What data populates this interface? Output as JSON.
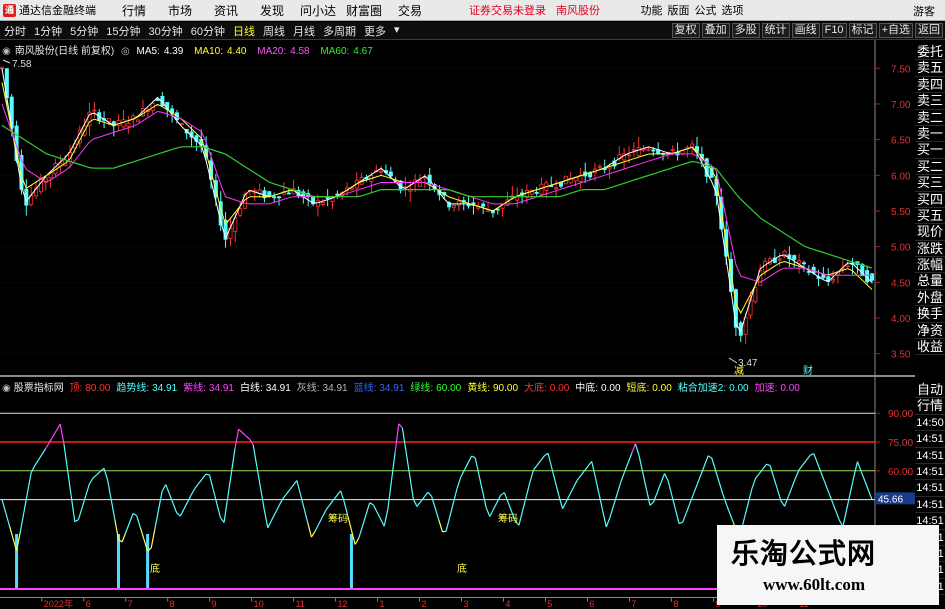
{
  "menubar": {
    "logo_glyph": "通",
    "app_title": "通达信金融终端",
    "items": [
      "行情",
      "市场",
      "资讯",
      "发现",
      "问小达",
      "财富圈",
      "交易"
    ],
    "login_warning": "证券交易未登录",
    "stock_name": "南风股份",
    "right_items": [
      "功能",
      "版面",
      "公式",
      "选项"
    ],
    "guest": "游客"
  },
  "toolbar": {
    "periods": [
      "分时",
      "1分钟",
      "5分钟",
      "15分钟",
      "30分钟",
      "60分钟",
      "日线",
      "周线",
      "月线",
      "多周期",
      "更多"
    ],
    "active_period": "日线",
    "right_buttons": [
      "复权",
      "叠加",
      "多股",
      "统计",
      "画线",
      "F10",
      "标记",
      "+自选",
      "返回"
    ]
  },
  "main_chart": {
    "title": "南风股份(日线 前复权)",
    "ma": [
      {
        "label": "MA5:",
        "value": "4.39",
        "color": "#ffffff"
      },
      {
        "label": "MA10:",
        "value": "4.40",
        "color": "#ffff33"
      },
      {
        "label": "MA20:",
        "value": "4.58",
        "color": "#ff33ff"
      },
      {
        "label": "MA60:",
        "value": "4.67",
        "color": "#33ee33"
      }
    ],
    "high_label": "7.58",
    "low_label": "3.47",
    "markers": [
      "减",
      "财"
    ],
    "price_axis": [
      "7.50",
      "7.00",
      "6.50",
      "6.00",
      "5.50",
      "5.00",
      "4.50",
      "4.00",
      "3.50"
    ],
    "colors": {
      "up": "#ff3232",
      "down": "#54ffff",
      "ma5": "#ffffff",
      "ma10": "#ffff33",
      "ma20": "#ff33ff",
      "ma60": "#33cc33"
    }
  },
  "quote_tabs": [
    "委托",
    "卖五",
    "卖四",
    "卖三",
    "卖二",
    "卖一",
    "买一",
    "买二",
    "买三",
    "买四",
    "买五",
    "现价",
    "涨跌",
    "涨幅",
    "总量",
    "外盘",
    "换手",
    "净资",
    "收益"
  ],
  "time_tabs": [
    "自动",
    "行情",
    "14:50",
    "14:51",
    "14:51",
    "14:51",
    "14:51",
    "14:51",
    "14:51",
    "14:51",
    "14:51",
    "14:51",
    "14:51"
  ],
  "indicator": {
    "name": "股票指标网",
    "params": [
      {
        "label": "顶:",
        "value": "80.00",
        "color": "#ff3333"
      },
      {
        "label": "趋势线:",
        "value": "34.91",
        "color": "#55ffff"
      },
      {
        "label": "紫线:",
        "value": "34.91",
        "color": "#ff44ff"
      },
      {
        "label": "白线:",
        "value": "34.91",
        "color": "#ffffff"
      },
      {
        "label": "灰线:",
        "value": "34.91",
        "color": "#bbbbbb"
      },
      {
        "label": "蓝线:",
        "value": "34.91",
        "color": "#3366ff"
      },
      {
        "label": "绿线:",
        "value": "60.00",
        "color": "#33ff33"
      },
      {
        "label": "黄线:",
        "value": "90.00",
        "color": "#ffff33"
      },
      {
        "label": "大底:",
        "value": "0.00",
        "color": "#ff3333"
      },
      {
        "label": "中底:",
        "value": "0.00",
        "color": "#ffffff"
      },
      {
        "label": "短底:",
        "value": "0.00",
        "color": "#ffff33"
      },
      {
        "label": "粘合加速2:",
        "value": "0.00",
        "color": "#55ffff"
      },
      {
        "label": "加速:",
        "value": "0.00",
        "color": "#ff44ff"
      }
    ],
    "axis": [
      "90.00",
      "75.00",
      "60.00",
      "45.00"
    ],
    "current": "45.66",
    "labels": [
      "底",
      "筹码",
      "底",
      "筹码"
    ]
  },
  "date_axis": [
    "2022年",
    "6",
    "7",
    "8",
    "9",
    "10",
    "11",
    "12",
    "1",
    "2",
    "3",
    "4",
    "5",
    "6",
    "7",
    "8",
    "9",
    "10",
    "11"
  ],
  "watermark": {
    "title": "乐淘公式网",
    "url": "www.60lt.com"
  },
  "chart_data": [
    {
      "type": "line",
      "title": "南风股份(日线 前复权)",
      "ylim": [
        3.3,
        7.7
      ],
      "series": [
        {
          "name": "MA5",
          "values": [
            7.5,
            5.6,
            6.0,
            6.3,
            6.9,
            6.7,
            6.8,
            7.1,
            6.7,
            6.4,
            5.1,
            5.8,
            5.7,
            5.8,
            5.6,
            5.7,
            5.9,
            6.1,
            5.8,
            6.0,
            5.6,
            5.6,
            5.5,
            5.7,
            5.8,
            5.9,
            6.0,
            6.1,
            6.3,
            6.4,
            6.3,
            6.4,
            5.8,
            3.7,
            4.7,
            4.9,
            4.7,
            4.5,
            4.8,
            4.5
          ]
        },
        {
          "name": "MA10",
          "values": [
            7.3,
            5.8,
            6.0,
            6.2,
            6.8,
            6.7,
            6.8,
            7.0,
            6.8,
            6.5,
            5.3,
            5.7,
            5.7,
            5.8,
            5.7,
            5.7,
            5.9,
            6.0,
            5.9,
            5.9,
            5.7,
            5.6,
            5.5,
            5.7,
            5.8,
            5.9,
            6.0,
            6.1,
            6.2,
            6.3,
            6.3,
            6.4,
            6.0,
            4.0,
            4.6,
            4.8,
            4.7,
            4.6,
            4.7,
            4.4
          ]
        },
        {
          "name": "MA20",
          "values": [
            7.0,
            6.1,
            5.9,
            6.1,
            6.5,
            6.6,
            6.7,
            6.9,
            6.8,
            6.6,
            5.7,
            5.6,
            5.6,
            5.7,
            5.7,
            5.7,
            5.8,
            5.9,
            5.9,
            5.9,
            5.8,
            5.7,
            5.6,
            5.6,
            5.7,
            5.8,
            5.9,
            6.0,
            6.1,
            6.2,
            6.3,
            6.3,
            6.1,
            4.6,
            4.5,
            4.7,
            4.7,
            4.6,
            4.6,
            4.6
          ]
        },
        {
          "name": "MA60",
          "values": [
            6.7,
            6.5,
            6.3,
            6.2,
            6.1,
            6.1,
            6.2,
            6.3,
            6.4,
            6.4,
            6.3,
            6.1,
            5.9,
            5.8,
            5.7,
            5.7,
            5.7,
            5.8,
            5.8,
            5.8,
            5.8,
            5.7,
            5.7,
            5.7,
            5.7,
            5.7,
            5.8,
            5.8,
            5.9,
            6.0,
            6.1,
            6.2,
            6.1,
            5.7,
            5.4,
            5.2,
            5.0,
            4.9,
            4.8,
            4.7
          ]
        }
      ]
    },
    {
      "type": "line",
      "title": "股票指标网",
      "ylim": [
        0,
        100
      ],
      "series": [
        {
          "name": "趋势线",
          "values": [
            45,
            18,
            60,
            72,
            85,
            30,
            55,
            62,
            20,
            40,
            15,
            55,
            35,
            50,
            60,
            30,
            82,
            75,
            30,
            45,
            55,
            25,
            40,
            50,
            20,
            45,
            30,
            90,
            40,
            50,
            25,
            55,
            70,
            35,
            50,
            30,
            60,
            70,
            40,
            55,
            65,
            30,
            55,
            75,
            40,
            60,
            30,
            50,
            70,
            45,
            25,
            55,
            65,
            40,
            60,
            70,
            50,
            30,
            65,
            45
          ]
        }
      ]
    }
  ]
}
